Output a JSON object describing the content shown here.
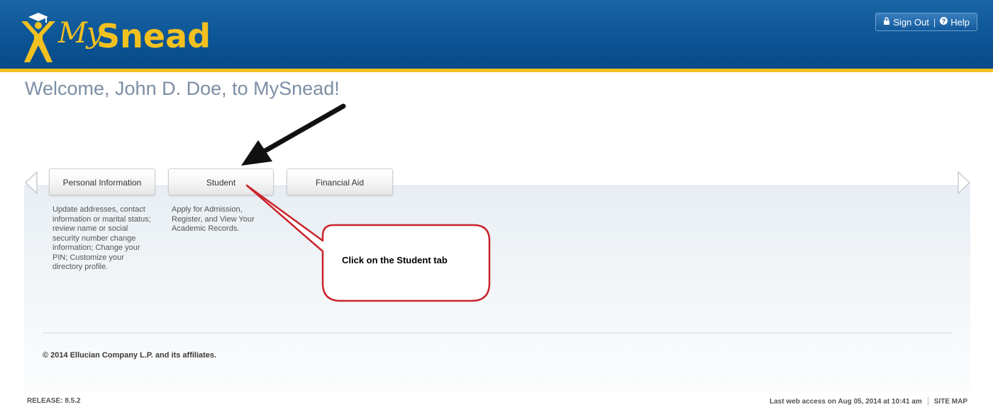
{
  "header": {
    "logo_my": "My",
    "logo_snead": "Snead",
    "sign_out_label": "Sign Out",
    "separator": "|",
    "help_label": "Help",
    "sign_out_icon": "lock-icon",
    "help_icon": "question-circle-icon",
    "colors": {
      "blue": "#0c5596",
      "gold": "#f3c11f"
    }
  },
  "welcome": "Welcome, John D. Doe, to MySnead!",
  "tabs": [
    {
      "label": "Personal Information",
      "description": "Update addresses, contact information or marital status; review name or social security number change information; Change your PIN; Customize your directory profile."
    },
    {
      "label": "Student",
      "description": "Apply for Admission, Register, and View Your Academic Records."
    },
    {
      "label": "Financial Aid",
      "description": ""
    }
  ],
  "annotation": {
    "callout_text": "Click on the Student tab",
    "callout_color": "#c9252c",
    "arrow_color": "#111111"
  },
  "copyright": "© 2014 Ellucian Company L.P. and its affiliates.",
  "footer": {
    "release": "RELEASE: 8.5.2",
    "last_access": "Last web access on Aug 05, 2014 at 10:41 am",
    "site_map": "SITE MAP"
  }
}
